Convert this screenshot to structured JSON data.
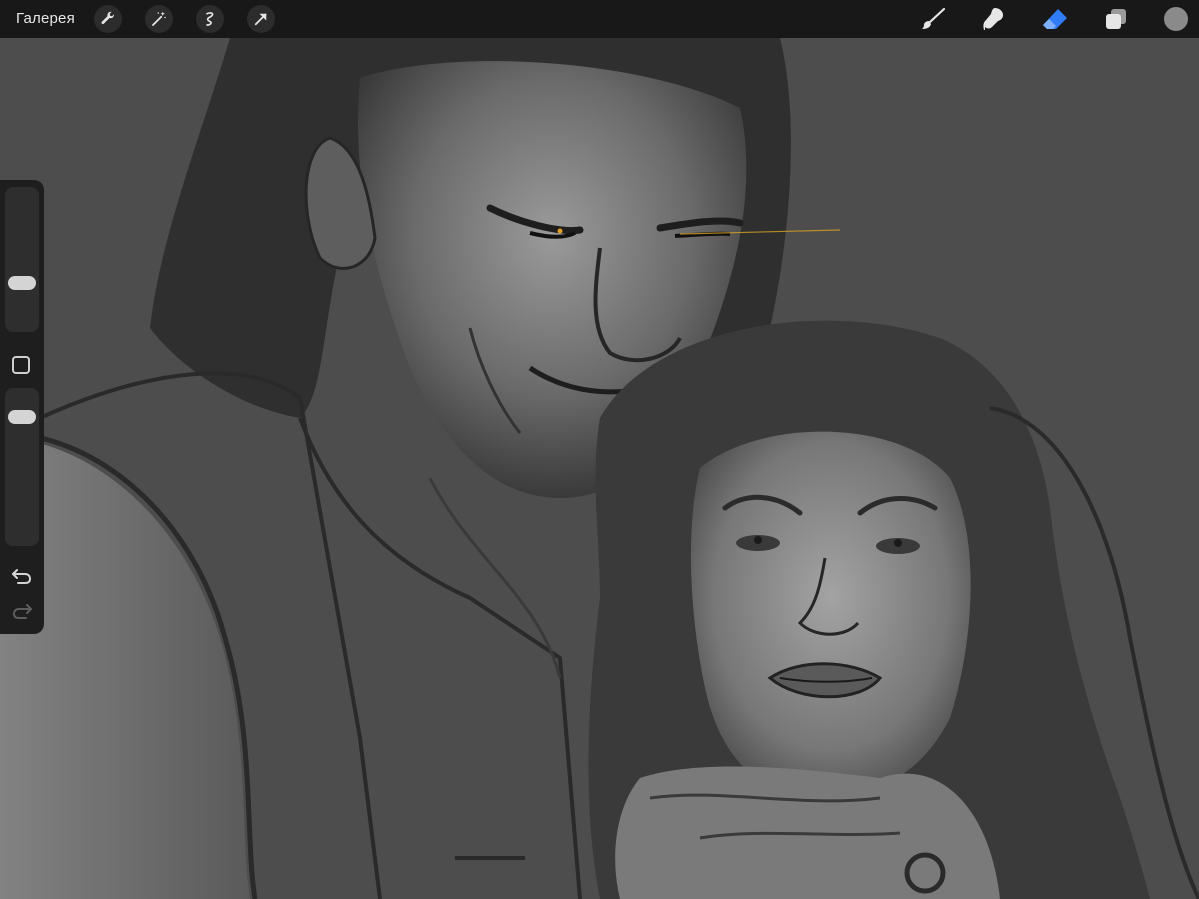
{
  "topbar": {
    "gallery_label": "Галерея",
    "left_tools": [
      "wrench-icon",
      "magic-wand-icon",
      "selection-icon",
      "transform-arrow-icon"
    ],
    "right_tools": [
      "brush-icon",
      "smudge-icon",
      "eraser-icon",
      "layers-icon",
      "color-icon"
    ],
    "active_tool": "eraser-icon",
    "accent_color": "#2f7cf6",
    "current_color": "#8a8a8a"
  },
  "sidebar": {
    "size_slider_value": 0.32,
    "opacity_slider_value": 0.85,
    "controls": [
      "brush-size-slider",
      "modify-button",
      "brush-opacity-slider",
      "undo-icon",
      "redo-icon"
    ]
  },
  "canvas": {
    "background": "#4d4d4d"
  }
}
